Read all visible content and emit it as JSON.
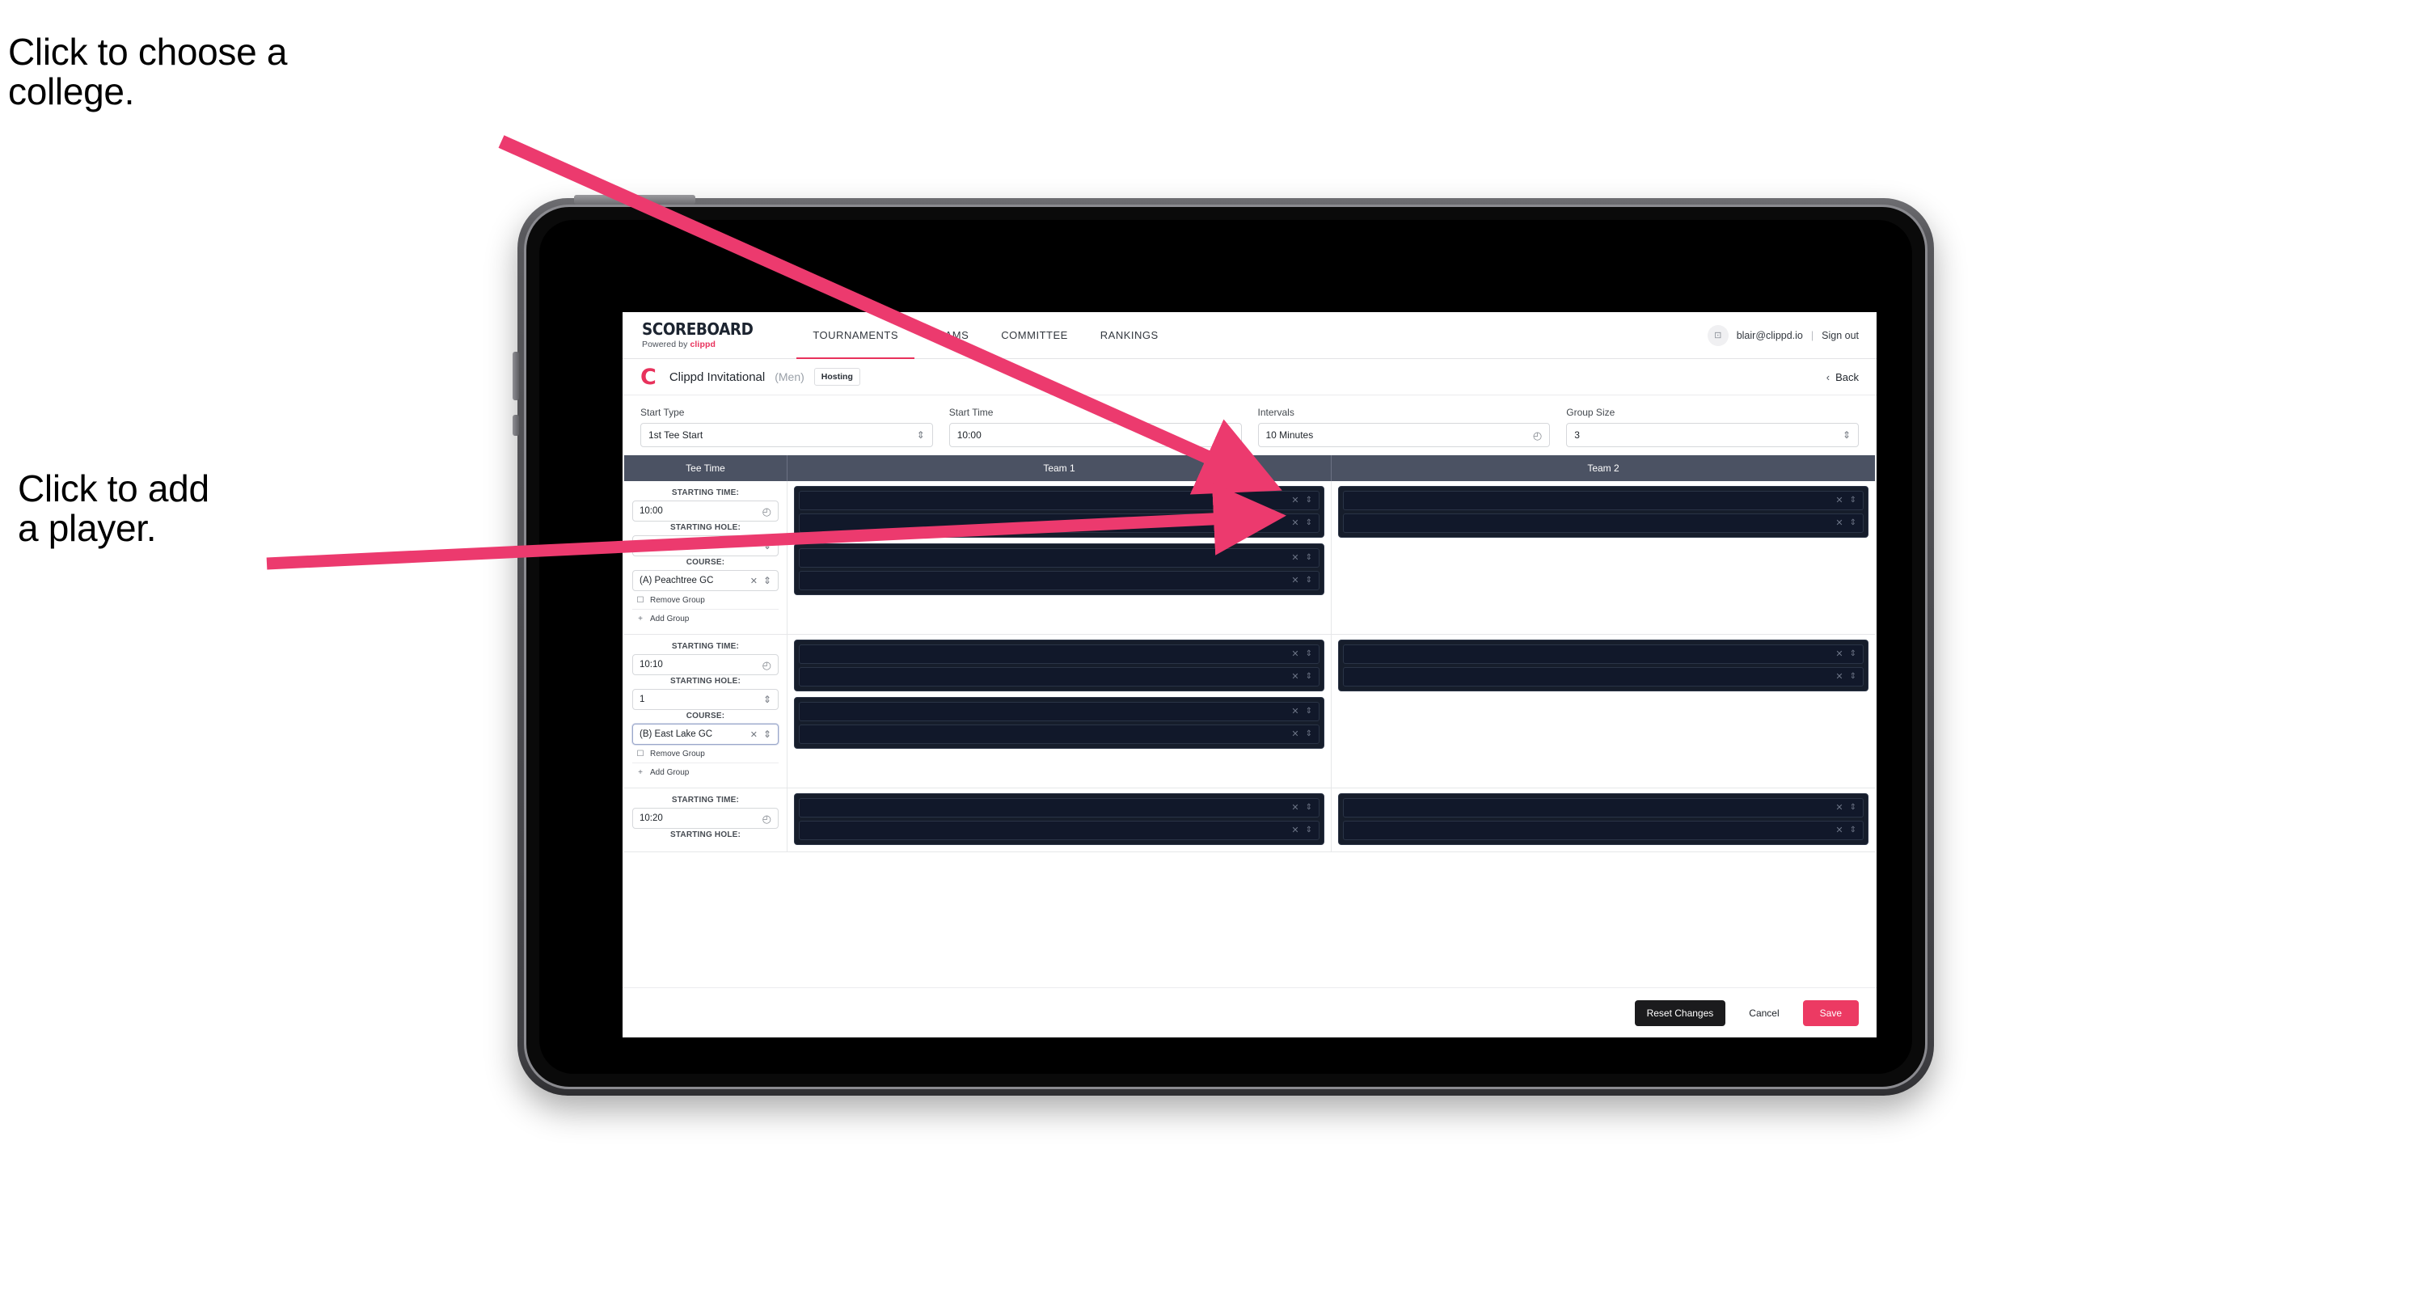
{
  "annotations": {
    "college": "Click to choose a\ncollege.",
    "player": "Click to add\na player."
  },
  "colors": {
    "accent": "#e8325c",
    "save": "#ec3a63",
    "header_row": "#4b5263",
    "card_dark": "#161d2b",
    "arrow": "#ec3a6e"
  },
  "navbar": {
    "brand_title": "SCOREBOARD",
    "brand_sub_prefix": "Powered by ",
    "brand_sub_name": "clippd",
    "tabs": [
      {
        "label": "TOURNAMENTS",
        "active": true
      },
      {
        "label": "TEAMS",
        "active": false
      },
      {
        "label": "COMMITTEE",
        "active": false
      },
      {
        "label": "RANKINGS",
        "active": false
      }
    ],
    "avatar_glyph": "⊡",
    "email": "blair@clippd.io",
    "separator": "|",
    "sign_out": "Sign out"
  },
  "subheader": {
    "logo_letter": "C",
    "tournament_name": "Clippd Invitational",
    "gender": "(Men)",
    "hosting_badge": "Hosting",
    "back_label": "Back",
    "back_chevron": "‹"
  },
  "config": [
    {
      "label": "Start Type",
      "value": "1st Tee Start",
      "control": "spinner"
    },
    {
      "label": "Start Time",
      "value": "10:00",
      "control": "clock"
    },
    {
      "label": "Intervals",
      "value": "10 Minutes",
      "control": "clock"
    },
    {
      "label": "Group Size",
      "value": "3",
      "control": "spinner"
    }
  ],
  "table": {
    "headers": [
      "Tee Time",
      "Team 1",
      "Team 2"
    ],
    "field_labels": {
      "time": "STARTING TIME:",
      "hole": "STARTING HOLE:",
      "course": "COURSE:"
    },
    "group_actions": {
      "remove": "Remove Group",
      "add": "Add Group",
      "remove_icon": "☐",
      "add_icon": "+"
    },
    "row_controls": {
      "clear": "✕",
      "spinner": "⇅"
    },
    "rows": [
      {
        "tee": {
          "time": "10:00",
          "hole": "1",
          "course": "(A) Peachtree GC",
          "course_focused": false
        },
        "team1_groups": [
          {
            "players": [
              "",
              ""
            ]
          },
          {
            "players": [
              "",
              ""
            ]
          }
        ],
        "team2_groups": [
          {
            "players": [
              "",
              ""
            ]
          }
        ]
      },
      {
        "tee": {
          "time": "10:10",
          "hole": "1",
          "course": "(B) East Lake GC",
          "course_focused": true
        },
        "team1_groups": [
          {
            "players": [
              "",
              ""
            ]
          },
          {
            "players": [
              "",
              ""
            ]
          }
        ],
        "team2_groups": [
          {
            "players": [
              "",
              ""
            ]
          }
        ]
      },
      {
        "tee": {
          "time": "10:20",
          "hole": "",
          "course": "",
          "course_focused": false
        },
        "team1_groups": [
          {
            "players": [
              "",
              ""
            ]
          }
        ],
        "team2_groups": [
          {
            "players": [
              "",
              ""
            ]
          }
        ]
      }
    ]
  },
  "footer": {
    "reset_label": "Reset Changes",
    "cancel_label": "Cancel",
    "save_label": "Save"
  }
}
